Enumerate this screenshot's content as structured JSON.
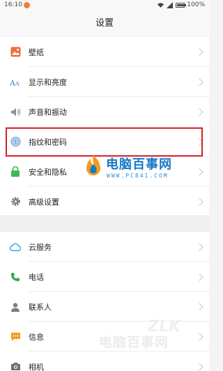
{
  "status": {
    "time": "16:10",
    "battery": "100%",
    "battery_level": 1.0
  },
  "title": "设置",
  "group1": [
    {
      "label": "壁纸",
      "icon": "wallpaper-icon"
    },
    {
      "label": "显示和亮度",
      "icon": "font-display-icon"
    },
    {
      "label": "声音和振动",
      "icon": "speaker-icon"
    },
    {
      "label": "指纹和密码",
      "icon": "fingerprint-icon"
    },
    {
      "label": "安全和隐私",
      "icon": "shield-icon"
    },
    {
      "label": "高级设置",
      "icon": "gear-icon"
    }
  ],
  "group2": [
    {
      "label": "云服务",
      "icon": "cloud-icon"
    },
    {
      "label": "电话",
      "icon": "phone-icon"
    },
    {
      "label": "联系人",
      "icon": "contact-icon"
    },
    {
      "label": "信息",
      "icon": "message-icon"
    },
    {
      "label": "相机",
      "icon": "camera-icon"
    }
  ],
  "watermark": {
    "title": "电脑百事网",
    "url": "WWW.PC841.COM",
    "corner_mark": "ZLK"
  },
  "colors": {
    "highlight": "#d8202a",
    "wallpaper": "#f06a3c",
    "font_display": "#3a82c8",
    "speaker": "#8a8f96",
    "fingerprint": "#4a90c8",
    "shield": "#3cba54",
    "gear": "#6b7178",
    "cloud": "#3aa0e0",
    "phone": "#2aaa4a",
    "contact": "#7a808a",
    "message": "#f0a020",
    "camera": "#6b7178"
  }
}
